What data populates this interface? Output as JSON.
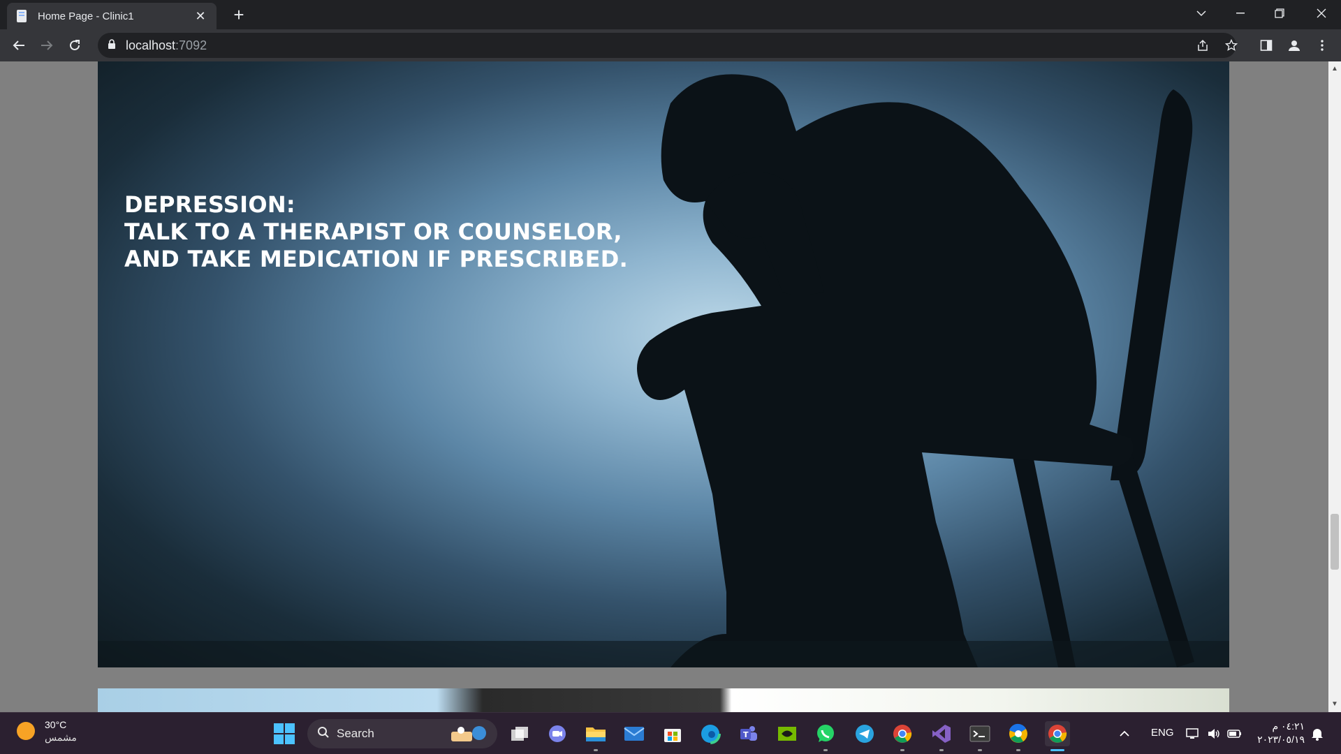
{
  "browser": {
    "tab_title": "Home Page - Clinic1",
    "url_host": "localhost",
    "url_port": ":7092"
  },
  "hero": {
    "line1": "DEPRESSION:",
    "line2": "TALK TO A THERAPIST OR COUNSELOR,",
    "line3": "AND TAKE MEDICATION IF PRESCRIBED."
  },
  "taskbar": {
    "weather_temp": "30°C",
    "weather_condition": "مشمس",
    "search_label": "Search",
    "language": "ENG",
    "time": "٠٤:٢١ م",
    "date": "٢٠٢٣/٠٥/١٩"
  },
  "colors": {
    "chrome_dark": "#202124",
    "chrome_toolbar": "#35363a",
    "taskbar_bg": "#2b2030",
    "accent": "#4cc2ff"
  }
}
